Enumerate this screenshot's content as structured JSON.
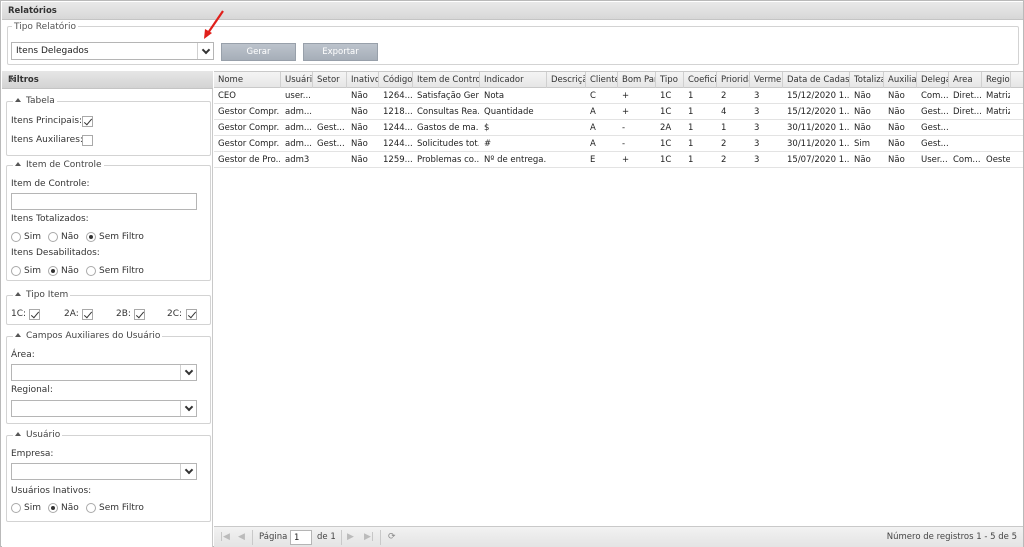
{
  "window": {
    "title": "Relatórios"
  },
  "report": {
    "legend": "Tipo Relatório",
    "selected": "Itens Delegados",
    "generate_label": "Gerar",
    "export_label": "Exportar"
  },
  "filters": {
    "title": "Filtros",
    "collapse_icon": "«",
    "tabela": {
      "legend": "Tabela",
      "principais_label": "Itens Principais:",
      "principais_checked": true,
      "auxiliares_label": "Itens Auxiliares:",
      "auxiliares_checked": false
    },
    "item_controle": {
      "legend": "Item de Controle",
      "field_label": "Item de Controle:",
      "field_value": "",
      "totalizados_label": "Itens Totalizados:",
      "desabilitados_label": "Itens Desabilitados:",
      "opt_sim": "Sim",
      "opt_nao": "Não",
      "opt_sem": "Sem Filtro",
      "totalizados_selected": "Sem Filtro",
      "desabilitados_selected": "Não"
    },
    "tipo_item": {
      "legend": "Tipo Item",
      "items": [
        {
          "label": "1C:",
          "checked": true
        },
        {
          "label": "2A:",
          "checked": true
        },
        {
          "label": "2B:",
          "checked": true
        },
        {
          "label": "2C:",
          "checked": true
        }
      ]
    },
    "campos_auxiliares": {
      "legend": "Campos Auxiliares do Usuário",
      "area_label": "Área:",
      "area_value": "",
      "regional_label": "Regional:",
      "regional_value": ""
    },
    "usuario": {
      "legend": "Usuário",
      "empresa_label": "Empresa:",
      "empresa_value": "",
      "inativos_label": "Usuários Inativos:",
      "opt_sim": "Sim",
      "opt_nao": "Não",
      "opt_sem": "Sem Filtro",
      "inativos_selected": "Não"
    }
  },
  "grid": {
    "columns": [
      "Nome",
      "Usuário",
      "Setor",
      "Inativo",
      "Código",
      "Item de Controle",
      "Indicador",
      "Descrição",
      "Cliente",
      "Bom Para",
      "Tipo",
      "Coeficiente",
      "Prioridade",
      "Vermelho",
      "Data de Cadastro",
      "Totalizado",
      "Auxiliar",
      "Delegado",
      "Area",
      "Regional"
    ],
    "rows": [
      [
        "CEO",
        "user...",
        "",
        "Não",
        "1264...",
        "Satisfação Ger...",
        "Nota",
        "",
        "C",
        "+",
        "1C",
        "1",
        "2",
        "3",
        "15/12/2020 1...",
        "Não",
        "Não",
        "Com...",
        "Diret...",
        "Matriz"
      ],
      [
        "Gestor Compr...",
        "adm...",
        "",
        "Não",
        "1218...",
        "Consultas Rea...",
        "Quantidade",
        "",
        "A",
        "+",
        "1C",
        "1",
        "4",
        "3",
        "15/12/2020 1...",
        "Não",
        "Não",
        "Gest...",
        "Diret...",
        "Matriz"
      ],
      [
        "Gestor Compr...",
        "adm...",
        "Gest...",
        "Não",
        "1244...",
        "Gastos de ma...",
        "$",
        "",
        "A",
        "-",
        "2A",
        "1",
        "1",
        "3",
        "30/11/2020 1...",
        "Não",
        "Não",
        "Gest...",
        "",
        ""
      ],
      [
        "Gestor Compr...",
        "adm...",
        "Gest...",
        "Não",
        "1244...",
        "Solicitudes tot...",
        "#",
        "",
        "A",
        "-",
        "1C",
        "1",
        "2",
        "3",
        "30/11/2020 1...",
        "Sim",
        "Não",
        "Gest...",
        "",
        ""
      ],
      [
        "Gestor de Pro...",
        "adm3",
        "",
        "Não",
        "1259...",
        "Problemas co...",
        "Nº de entrega...",
        "",
        "E",
        "+",
        "1C",
        "1",
        "2",
        "3",
        "15/07/2020 1...",
        "Não",
        "Não",
        "User...",
        "Com...",
        "Oeste"
      ]
    ],
    "pager": {
      "page_label": "Página",
      "page_value": "1",
      "of_label": "de 1",
      "records_label": "Número de registros 1 - 5 de 5"
    }
  },
  "colors": {
    "button_bg": "#a9b1bb",
    "arrow": "#e0201b"
  }
}
